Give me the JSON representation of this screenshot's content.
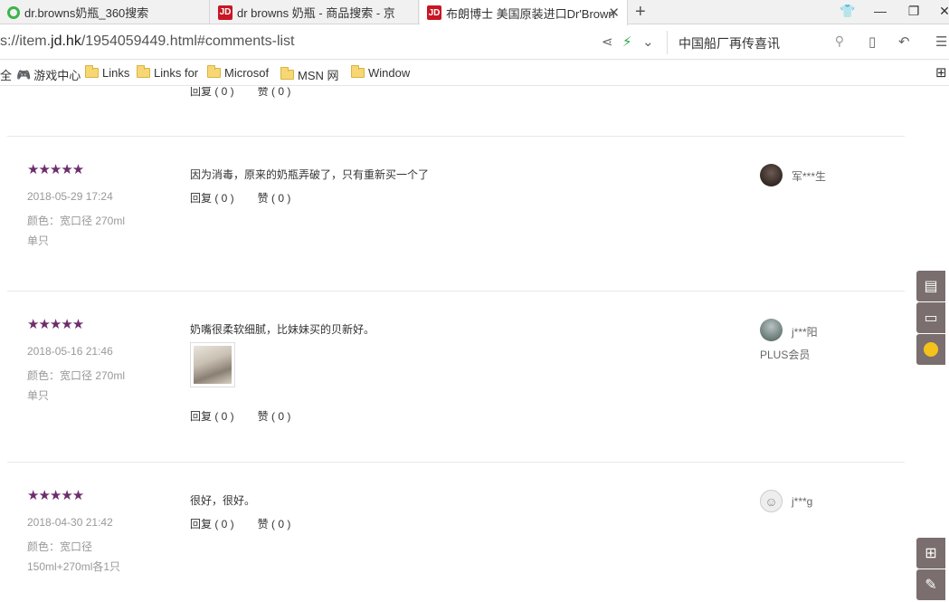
{
  "tabs": [
    {
      "title": "dr.browns奶瓶_360搜索",
      "icon": "360-search-icon"
    },
    {
      "title": "dr browns 奶瓶 - 商品搜索 - 京",
      "icon": "jd-icon"
    },
    {
      "title": "布朗博士 美国原装进口Dr'Brown",
      "icon": "jd-icon"
    }
  ],
  "jd_favicon": "JD",
  "window": {
    "new_tab": "+",
    "skin": "👕",
    "minimize": "—",
    "restore": "❐",
    "close": "✕"
  },
  "address": {
    "url_prefix": "s://item.",
    "url_domain": "jd.hk",
    "url_suffix": "/1954059449.html#comments-list",
    "search_text": "中国船厂再传喜讯"
  },
  "bookmarks": [
    "全",
    "游戏中心",
    "Links",
    "Links for",
    "Microsof",
    "MSN 网",
    "Window"
  ],
  "review_top": {
    "reply": "回复 ( 0 )",
    "like": "赞 ( 0 )"
  },
  "reviews": [
    {
      "stars": "★★★★★",
      "date": "2018-05-29 17:24",
      "attr": "颜色：宽口径 270ml单只",
      "text": "因为消毒，原来的奶瓶弄破了，只有重新买一个了",
      "reply": "回复 ( 0 )",
      "like": "赞 ( 0 )",
      "user": "军***生"
    },
    {
      "stars": "★★★★★",
      "date": "2018-05-16 21:46",
      "attr": "颜色：宽口径 270ml单只",
      "text": "奶嘴很柔软细腻，比妹妹买的贝新好。",
      "reply": "回复 ( 0 )",
      "like": "赞 ( 0 )",
      "user": "j***阳",
      "badge": "PLUS会员"
    },
    {
      "stars": "★★★★★",
      "date": "2018-04-30 21:42",
      "attr": "颜色：宽口径 150ml+270ml各1只",
      "text": "很好，很好。",
      "reply": "回复 ( 0 )",
      "like": "赞 ( 0 )",
      "user": "j***g"
    }
  ]
}
